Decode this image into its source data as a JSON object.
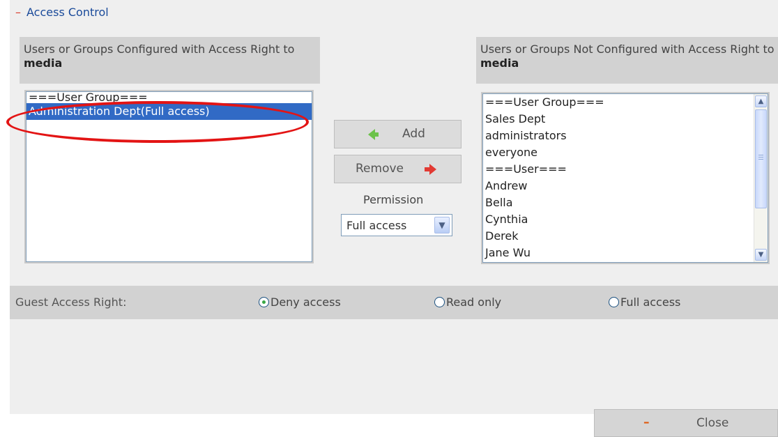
{
  "section": {
    "toggle": "–",
    "title": "Access Control"
  },
  "left_box": {
    "header_text": "Users or Groups Configured with Access Right to ",
    "header_bold": "media",
    "items": [
      {
        "label": "===User Group===",
        "selected": false
      },
      {
        "label": "Administration Dept(Full access)",
        "selected": true
      }
    ]
  },
  "right_box": {
    "header_text": "Users or Groups Not Configured with Access Right to ",
    "header_bold": "media",
    "items": [
      {
        "label": "===User Group==="
      },
      {
        "label": "Sales Dept"
      },
      {
        "label": "administrators"
      },
      {
        "label": "everyone"
      },
      {
        "label": "===User==="
      },
      {
        "label": "Andrew"
      },
      {
        "label": "Bella"
      },
      {
        "label": "Cynthia"
      },
      {
        "label": "Derek"
      },
      {
        "label": "Jane Wu"
      }
    ]
  },
  "actions": {
    "add_label": "Add",
    "remove_label": "Remove"
  },
  "permission": {
    "label": "Permission",
    "value": "Full access"
  },
  "guest": {
    "label": "Guest Access Right:",
    "options": [
      {
        "label": "Deny access",
        "checked": true
      },
      {
        "label": "Read only",
        "checked": false
      },
      {
        "label": "Full access",
        "checked": false
      }
    ]
  },
  "footer": {
    "close_label": "Close",
    "close_icon": "–"
  },
  "colors": {
    "accent": "#1a4a9a",
    "selection": "#316ac5",
    "highlight_oval": "#e31414",
    "add_arrow": "#6cc24a",
    "remove_arrow": "#e23a33"
  }
}
